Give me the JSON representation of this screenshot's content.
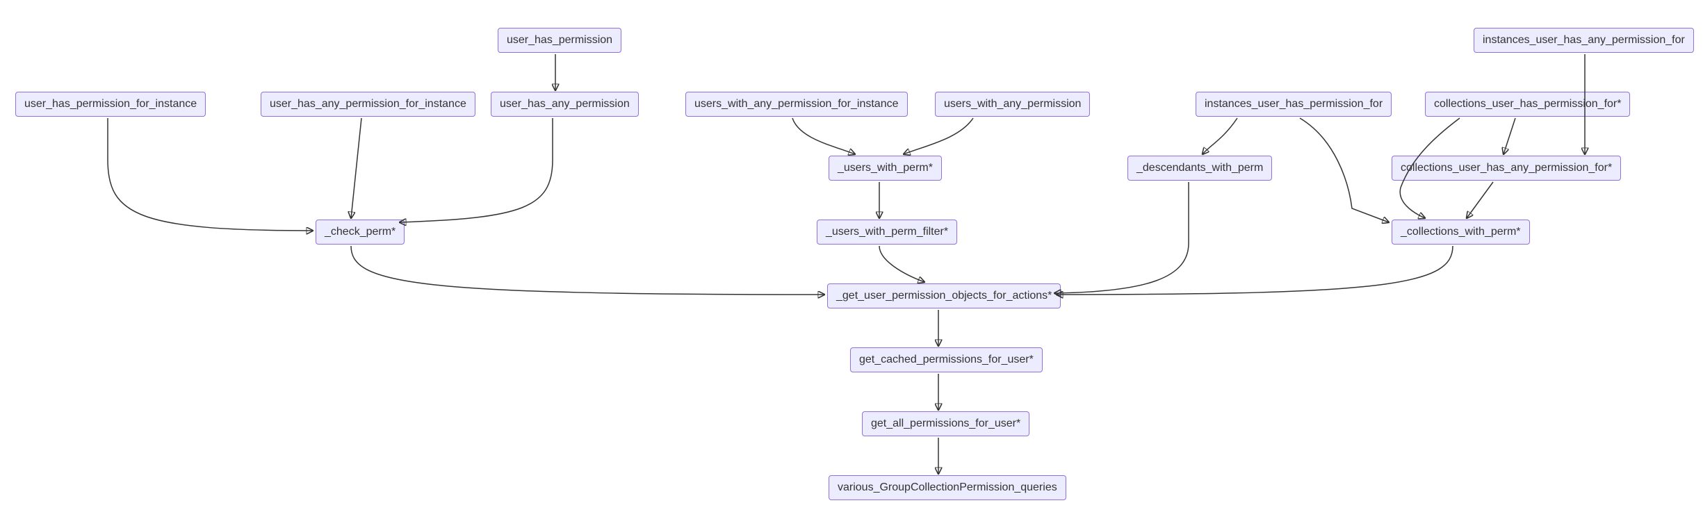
{
  "nodes": {
    "user_has_permission": "user_has_permission",
    "instances_user_has_any_permission_for": "instances_user_has_any_permission_for",
    "user_has_permission_for_instance": "user_has_permission_for_instance",
    "user_has_any_permission_for_instance": "user_has_any_permission_for_instance",
    "user_has_any_permission": "user_has_any_permission",
    "users_with_any_permission_for_instance": "users_with_any_permission_for_instance",
    "users_with_any_permission": "users_with_any_permission",
    "instances_user_has_permission_for": "instances_user_has_permission_for",
    "collections_user_has_permission_for": "collections_user_has_permission_for*",
    "users_with_perm": "_users_with_perm*",
    "descendants_with_perm": "_descendants_with_perm",
    "collections_user_has_any_permission_for": "collections_user_has_any_permission_for*",
    "check_perm": "_check_perm*",
    "users_with_perm_filter": "_users_with_perm_filter*",
    "collections_with_perm": "_collections_with_perm*",
    "get_user_permission_objects_for_actions": "_get_user_permission_objects_for_actions*",
    "get_cached_permissions_for_user": "get_cached_permissions_for_user*",
    "get_all_permissions_for_user": "get_all_permissions_for_user*",
    "various_GroupCollectionPermission_queries": "various_GroupCollectionPermission_queries"
  }
}
